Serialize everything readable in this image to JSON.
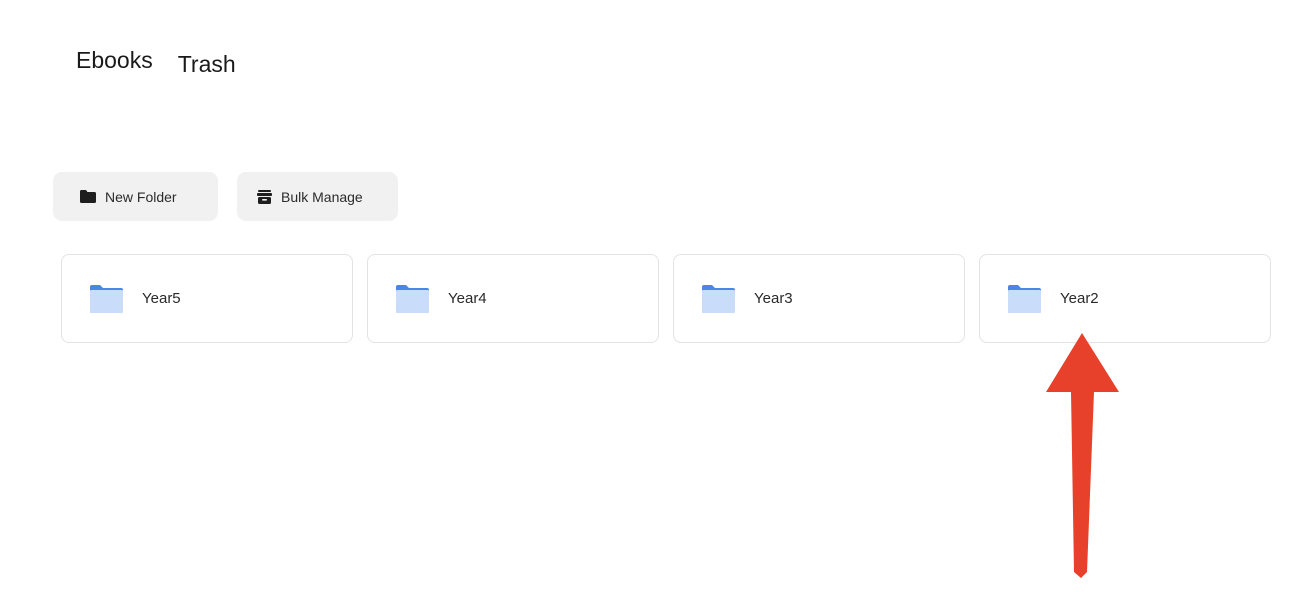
{
  "tabs": [
    {
      "label": "Ebooks"
    },
    {
      "label": "Trash"
    }
  ],
  "toolbar": {
    "new_folder_label": "New Folder",
    "bulk_manage_label": "Bulk Manage"
  },
  "folders": [
    {
      "name": "Year5"
    },
    {
      "name": "Year4"
    },
    {
      "name": "Year3"
    },
    {
      "name": "Year2"
    }
  ],
  "colors": {
    "folder_light": "#c9ddfb",
    "folder_dark": "#4a86e8",
    "button_bg": "#f1f1f1",
    "card_border": "#e3e3e3",
    "annotation_arrow": "#e8412b"
  },
  "icons": {
    "new_folder": "folder-icon",
    "bulk_manage": "archive-box-icon",
    "folder_card": "folder-icon",
    "annotation": "arrow-up-icon"
  }
}
